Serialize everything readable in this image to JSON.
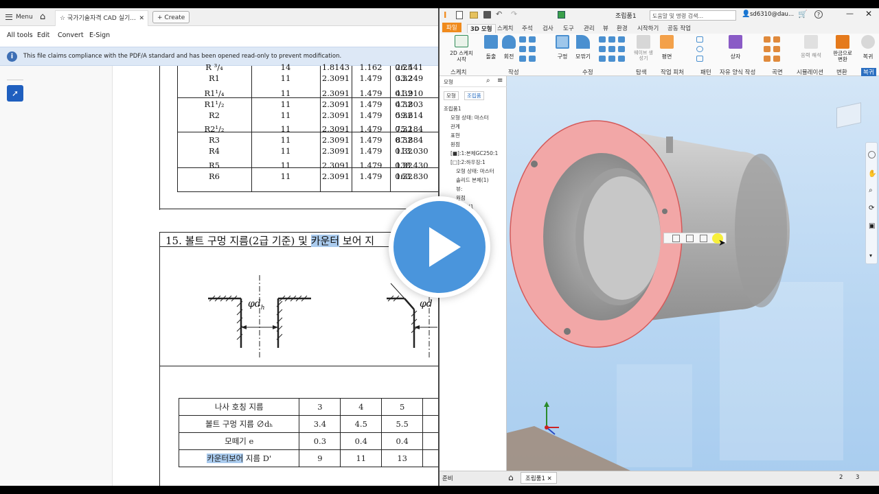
{
  "pdf": {
    "tabs": {
      "menu": "Menu",
      "doc_tab": "국가기술자격 CAD 실기...",
      "create": "Create"
    },
    "menubar": [
      "All tools",
      "Edit",
      "Convert",
      "E-Sign"
    ],
    "notice": "This file claims compliance with the PDF/A standard and has been opened read-only to prevent modification.",
    "thread_table": {
      "rows": [
        [
          "R ³/₄",
          "14",
          "1.8143",
          "1.162",
          "0.25",
          "26.441"
        ],
        [
          "R1",
          "11",
          "2.3091",
          "1.479",
          "0.32",
          "33.249"
        ],
        [
          "R1¹/₄",
          "11",
          "2.3091",
          "1.479",
          "0.32",
          "41.910"
        ],
        [
          "R1¹/₂",
          "11",
          "2.3091",
          "1.479",
          "0.32",
          "47.803"
        ],
        [
          "R2",
          "11",
          "2.3091",
          "1.479",
          "0.32",
          "59.614"
        ],
        [
          "R2¹/₂",
          "11",
          "2.3091",
          "1.479",
          "0.32",
          "75.184"
        ],
        [
          "R3",
          "11",
          "2.3091",
          "1.479",
          "0.32",
          "87.884"
        ],
        [
          "R4",
          "11",
          "2.3091",
          "1.479",
          "0.32",
          "113.030"
        ],
        [
          "R5",
          "11",
          "2.3091",
          "1.479",
          "0.32",
          "138.430"
        ],
        [
          "R6",
          "11",
          "2.3091",
          "1.479",
          "0.32",
          "163.830"
        ]
      ]
    },
    "section": {
      "title_pre": "15. 볼트 구멍 지름(2급 기준) 및 ",
      "title_hl": "카운터",
      "title_post": " 보어 지",
      "dim_label": "φd",
      "dim_sub": "h"
    },
    "bolt_table": {
      "rows": [
        {
          "label": "나사 호칭 지름",
          "values": [
            "3",
            "4",
            "5"
          ]
        },
        {
          "label": "볼트 구멍 지름 ∅dₕ",
          "values": [
            "3.4",
            "4.5",
            "5.5"
          ]
        },
        {
          "label": "모떼기 e",
          "values": [
            "0.3",
            "0.4",
            "0.4"
          ]
        },
        {
          "label_hl": "카운터보어",
          "label_post": " 지름 D'",
          "values": [
            "9",
            "11",
            "13"
          ]
        }
      ]
    }
  },
  "inventor": {
    "doc_title": "조립품1",
    "search_placeholder": "도움말 및 명령 검색...",
    "user": "sd6310@dau...",
    "tabs": [
      "파일",
      "3D 모형",
      "스케치",
      "주석",
      "검사",
      "도구",
      "관리",
      "뷰",
      "환경",
      "시작하기",
      "공동 작업"
    ],
    "ribbon_groups": [
      "스케치",
      "작성",
      "수정",
      "탐색",
      "작업 피처",
      "패턴",
      "자유 양식 작성",
      "곡면",
      "시뮬레이션",
      "변환",
      "복귀"
    ],
    "ribbon_buttons": {
      "sketch": "2D 스케치 시작",
      "extrude": "돌출",
      "revolve": "회전",
      "hole": "구멍",
      "fillet": "모깎기",
      "surface": "곡면",
      "freeform": "상자",
      "sheetmetal": "판금으로 변환",
      "return": "복귀",
      "plane": "평면",
      "simulation": "응력 해석",
      "explore": "웨이브 생성기"
    },
    "browser_tabs": [
      "모형",
      "조립품"
    ],
    "browser_items": [
      "조립품1",
      "모형 상태: 마스터",
      "관계",
      "표현",
      "원점",
      "[■]:1:본체GC250:1",
      "[□]:2:하우징:1",
      "모형 상태: 마스터",
      "솔리드 본체(1)",
      "뷰:",
      "원점",
      "스케치1"
    ],
    "status": {
      "ready": "준비",
      "num1": "2",
      "num2": "3",
      "tab": "조립품1"
    }
  },
  "colors": {
    "accent_blue": "#4a95dc",
    "inventor_orange": "#f08a1c",
    "highlight": "#aacbee",
    "face_red": "#f2a7a7"
  }
}
